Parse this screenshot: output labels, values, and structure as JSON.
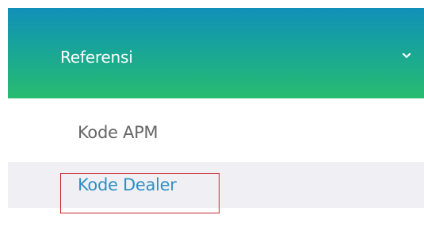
{
  "menu": {
    "section_label": "Referensi",
    "expand_icon": "chevron-down-icon",
    "items": [
      {
        "label": "Kode APM",
        "active": false
      },
      {
        "label": "Kode Dealer",
        "active": true
      }
    ]
  },
  "colors": {
    "header_gradient_top": "#1090b8",
    "header_gradient_bottom": "#28bc70",
    "active_text": "#2f8fc4",
    "inactive_text": "#666666",
    "active_background": "#f0f0f4",
    "highlight_border": "#c4262d"
  }
}
